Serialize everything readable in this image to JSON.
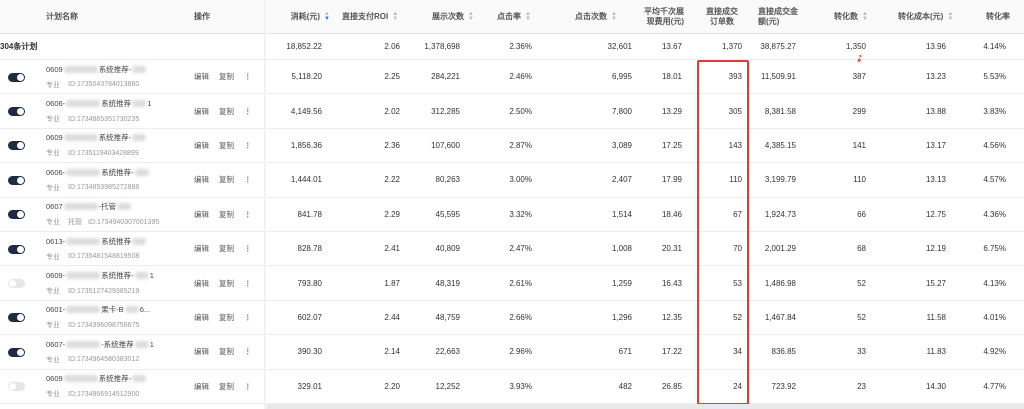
{
  "columns": {
    "name": "计划名称",
    "ops": "操作",
    "cost": "消耗(元)",
    "roi": "直接支付ROI",
    "impressions": "展示次数",
    "ctr": "点击率",
    "clicks": "点击次数",
    "cpm_l1": "平均千次展",
    "cpm_l2": "现费用(元)",
    "orders_l1": "直接成交",
    "orders_l2": "订单数",
    "gmv_l1": "直接成交金",
    "gmv_l2": "额(元)",
    "conv": "转化数",
    "conv_cost": "转化成本(元)",
    "conv_rate": "转化率"
  },
  "summary": {
    "label": "304条计划",
    "cost": "18,852.22",
    "roi": "2.06",
    "impressions": "1,378,698",
    "ctr": "2.36%",
    "clicks": "32,601",
    "cpm": "13.67",
    "orders": "1,370",
    "gmv": "38,875.27",
    "conv": "1,350",
    "conv_cost": "13.96",
    "conv_rate": "4.14%"
  },
  "ops_labels": {
    "edit": "编辑",
    "copy": "复制",
    "more": "⋮"
  },
  "rows": [
    {
      "on": true,
      "name_a": "0609",
      "name_b": "系统推荐-",
      "name_c": "",
      "tag": "专业",
      "tag2": "",
      "id": "ID:1735043784013860",
      "cost": "5,118.20",
      "roi": "2.25",
      "impressions": "284,221",
      "ctr": "2.46%",
      "clicks": "6,995",
      "cpm": "18.01",
      "orders": "393",
      "gmv": "11,509.91",
      "conv": "387",
      "conv_cost": "13.23",
      "conv_rate": "5.53%"
    },
    {
      "on": true,
      "name_a": "0606-",
      "name_b": "系统推荐",
      "name_c": "1",
      "tag": "专业",
      "tag2": "",
      "id": "ID:1734865351730235",
      "cost": "4,149.56",
      "roi": "2.02",
      "impressions": "312,285",
      "ctr": "2.50%",
      "clicks": "7,800",
      "cpm": "13.29",
      "orders": "305",
      "gmv": "8,381.58",
      "conv": "299",
      "conv_cost": "13.88",
      "conv_rate": "3.83%"
    },
    {
      "on": true,
      "name_a": "0609",
      "name_b": "系统推荐-",
      "name_c": "",
      "tag": "专业",
      "tag2": "",
      "id": "ID:1735119403428899",
      "cost": "1,856.36",
      "roi": "2.36",
      "impressions": "107,600",
      "ctr": "2.87%",
      "clicks": "3,089",
      "cpm": "17.25",
      "orders": "143",
      "gmv": "4,385.15",
      "conv": "141",
      "conv_cost": "13.17",
      "conv_rate": "4.56%"
    },
    {
      "on": true,
      "name_a": "0606-",
      "name_b": "系统推荐-",
      "name_c": "",
      "tag": "专业",
      "tag2": "",
      "id": "ID:1734853985272888",
      "cost": "1,444.01",
      "roi": "2.22",
      "impressions": "80,263",
      "ctr": "3.00%",
      "clicks": "2,407",
      "cpm": "17.99",
      "orders": "110",
      "gmv": "3,199.79",
      "conv": "110",
      "conv_cost": "13.13",
      "conv_rate": "4.57%"
    },
    {
      "on": true,
      "name_a": "0607",
      "name_b": "-托管",
      "name_c": "",
      "tag": "专业",
      "tag2": "托管",
      "id": "ID:1734940307001395",
      "cost": "841.78",
      "roi": "2.29",
      "impressions": "45,595",
      "ctr": "3.32%",
      "clicks": "1,514",
      "cpm": "18.46",
      "orders": "67",
      "gmv": "1,924.73",
      "conv": "66",
      "conv_cost": "12.75",
      "conv_rate": "4.36%"
    },
    {
      "on": true,
      "name_a": "0613-",
      "name_b": "系统推荐",
      "name_c": "",
      "tag": "专业",
      "tag2": "",
      "id": "ID:1735481548819508",
      "cost": "828.78",
      "roi": "2.41",
      "impressions": "40,809",
      "ctr": "2.47%",
      "clicks": "1,008",
      "cpm": "20.31",
      "orders": "70",
      "gmv": "2,001.29",
      "conv": "68",
      "conv_cost": "12.19",
      "conv_rate": "6.75%"
    },
    {
      "on": false,
      "name_a": "0609-",
      "name_b": "系统推荐-",
      "name_c": "1",
      "tag": "专业",
      "tag2": "",
      "id": "ID:1735127429385219",
      "cost": "793.80",
      "roi": "1.87",
      "impressions": "48,319",
      "ctr": "2.61%",
      "clicks": "1,259",
      "cpm": "16.43",
      "orders": "53",
      "gmv": "1,486.98",
      "conv": "52",
      "conv_cost": "15.27",
      "conv_rate": "4.13%"
    },
    {
      "on": true,
      "name_a": "0601-",
      "name_b": "果卡-B",
      "name_c": "6...",
      "tag": "专业",
      "tag2": "",
      "id": "ID:1734396098756675",
      "cost": "602.07",
      "roi": "2.44",
      "impressions": "48,759",
      "ctr": "2.66%",
      "clicks": "1,296",
      "cpm": "12.35",
      "orders": "52",
      "gmv": "1,467.84",
      "conv": "52",
      "conv_cost": "11.58",
      "conv_rate": "4.01%"
    },
    {
      "on": true,
      "name_a": "0607-",
      "name_b": "-系统推荐",
      "name_c": "1",
      "tag": "专业",
      "tag2": "",
      "id": "ID:1734964580383012",
      "cost": "390.30",
      "roi": "2.14",
      "impressions": "22,663",
      "ctr": "2.96%",
      "clicks": "671",
      "cpm": "17.22",
      "orders": "34",
      "gmv": "836.85",
      "conv": "33",
      "conv_cost": "11.83",
      "conv_rate": "4.92%"
    },
    {
      "on": false,
      "name_a": "0609",
      "name_b": "系统推荐-",
      "name_c": "",
      "tag": "专业",
      "tag2": "",
      "id": "ID:1734966914512900",
      "cost": "329.01",
      "roi": "2.20",
      "impressions": "12,252",
      "ctr": "3.93%",
      "clicks": "482",
      "cpm": "26.85",
      "orders": "24",
      "gmv": "723.92",
      "conv": "23",
      "conv_cost": "14.30",
      "conv_rate": "4.77%"
    }
  ],
  "colors": {
    "highlight": "#e53935",
    "toggle_on": "#1f2a44",
    "toggle_off": "#e6e6e6",
    "sort_active": "#3a6df0"
  }
}
